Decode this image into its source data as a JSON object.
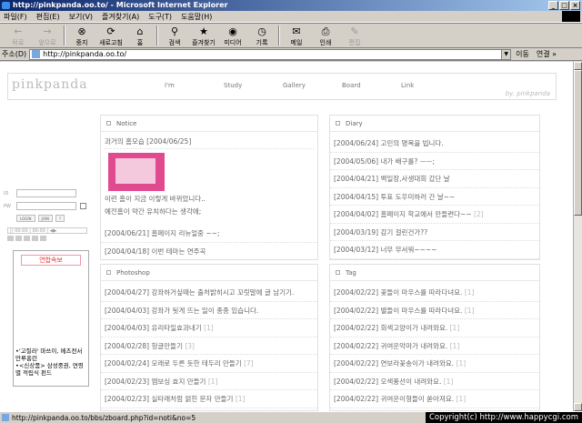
{
  "window": {
    "title": "http://pinkpanda.oo.to/ - Microsoft Internet Explorer",
    "buttons": [
      "_",
      "□",
      "×"
    ]
  },
  "menu": [
    "파일(F)",
    "편집(E)",
    "보기(V)",
    "즐겨찾기(A)",
    "도구(T)",
    "도움말(H)"
  ],
  "toolbar": [
    {
      "label": "뒤로",
      "icon": "back-arrow-icon",
      "glyph": "←",
      "disabled": true
    },
    {
      "label": "앞으로",
      "icon": "forward-arrow-icon",
      "glyph": "→",
      "disabled": true
    },
    {
      "label": "중지",
      "icon": "stop-icon",
      "glyph": "⊗",
      "disabled": false
    },
    {
      "label": "새로고침",
      "icon": "refresh-icon",
      "glyph": "⟳",
      "disabled": false
    },
    {
      "label": "홈",
      "icon": "home-icon",
      "glyph": "⌂",
      "disabled": false
    },
    {
      "label": "검색",
      "icon": "search-icon",
      "glyph": "⚲",
      "disabled": false
    },
    {
      "label": "즐겨찾기",
      "icon": "favorites-icon",
      "glyph": "★",
      "disabled": false
    },
    {
      "label": "미디어",
      "icon": "media-icon",
      "glyph": "◉",
      "disabled": false
    },
    {
      "label": "기록",
      "icon": "history-icon",
      "glyph": "◷",
      "disabled": false
    },
    {
      "label": "메일",
      "icon": "mail-icon",
      "glyph": "✉",
      "disabled": false
    },
    {
      "label": "인쇄",
      "icon": "print-icon",
      "glyph": "⎙",
      "disabled": false
    },
    {
      "label": "편집",
      "icon": "edit-icon",
      "glyph": "✎",
      "disabled": true
    }
  ],
  "address": {
    "label": "주소(D)",
    "url": "http://pinkpanda.oo.to/",
    "go": "이동",
    "links": "연결 »"
  },
  "site": {
    "logo": "pinkpanda",
    "by": "by. pinkpanda",
    "nav": [
      "I'm",
      "Study",
      "Gallery",
      "Board",
      "Link"
    ]
  },
  "sidebar": {
    "id_label": "ID",
    "pw_label": "PW",
    "buttons": [
      "LOGIN",
      "JOIN",
      "?"
    ],
    "player": "|)      00:00 | 00:00 | ◀▶",
    "realtime_title": "연합속보",
    "news": [
      "•'고질라' 마쓰이, 메츠전서 만루홈런",
      "•<신상품> 삼성중권, 연령별 적립식 펀드"
    ]
  },
  "notice": {
    "title": "Notice",
    "headline": "과거의 홈모습   [2004/06/25]",
    "body1": "이런 홈이 지금 이렇게 바뀌었니다..",
    "body2": "예전홈이 약간 유치하다는 생각에;",
    "rows": [
      {
        "text": "[2004/06/21] 홈페이지 리뉴얼중 ~~;",
        "count": ""
      },
      {
        "text": "[2004/04/18] 이번 테마는 연주곡",
        "count": ""
      }
    ]
  },
  "diary": {
    "title": "Diary",
    "rows": [
      {
        "text": "[2004/06/24] 고민의 명복을 빕니다.",
        "count": ""
      },
      {
        "text": "[2004/05/06] 내가 배구를? ㅡㅡ;",
        "count": ""
      },
      {
        "text": "[2004/04/21] 백일장,사생대회 갔단 날",
        "count": ""
      },
      {
        "text": "[2004/04/15] 투표 도우미하러 간 날~~",
        "count": ""
      },
      {
        "text": "[2004/04/02] 홈페이지 학교에서 만들련다~~",
        "count": "[2]"
      },
      {
        "text": "[2004/03/19] 감기 걸린건가??",
        "count": ""
      },
      {
        "text": "[2004/03/12] 너무 무서워~~~~",
        "count": ""
      }
    ]
  },
  "photoshop": {
    "title": "Photoshop",
    "rows": [
      {
        "text": "[2004/04/27] 강좌하거싶때는 출처밝히시고 꼬릿말에 글 남기기.",
        "count": ""
      },
      {
        "text": "[2004/04/03] 강좌가 됫게 뜨는 일이 종종 있습니다.",
        "count": ""
      },
      {
        "text": "[2004/04/03] 유리타일효과내기",
        "count": "[1]"
      },
      {
        "text": "[2004/02/28] 헝글만들기",
        "count": "[3]"
      },
      {
        "text": "[2004/02/24] 모래로 두른 듯한 테두리 만들기",
        "count": "[7]"
      },
      {
        "text": "[2004/02/23] 엠보싱 효지 만들기",
        "count": "[1]"
      },
      {
        "text": "[2004/02/23] 실타래처럼 얽힌 문자 만들기",
        "count": "[1]"
      }
    ]
  },
  "tag": {
    "title": "Tag",
    "rows": [
      {
        "text": "[2004/02/22] 꽃들이 마우스를 따라다녀요.",
        "count": "[1]"
      },
      {
        "text": "[2004/02/22] 별들이 마우스를 따라다녀요.",
        "count": "[1]"
      },
      {
        "text": "[2004/02/22] 회색고양이가 내려와요.",
        "count": "[1]"
      },
      {
        "text": "[2004/02/22] 귀여운악마가 내려와요.",
        "count": "[1]"
      },
      {
        "text": "[2004/02/22] 연보라꽃송이가 내려와요.",
        "count": "[1]"
      },
      {
        "text": "[2004/02/22] 오색풍선이 내려와요.",
        "count": "[1]"
      },
      {
        "text": "[2004/02/22] 귀여운이형들이 쏟아져요.",
        "count": "[1]"
      }
    ]
  },
  "status": {
    "url": "http://pinkpanda.oo.to/bbs/zboard.php?id=noti&no=5",
    "copyright": "Copyright(c) http://www.happycgi.com"
  }
}
